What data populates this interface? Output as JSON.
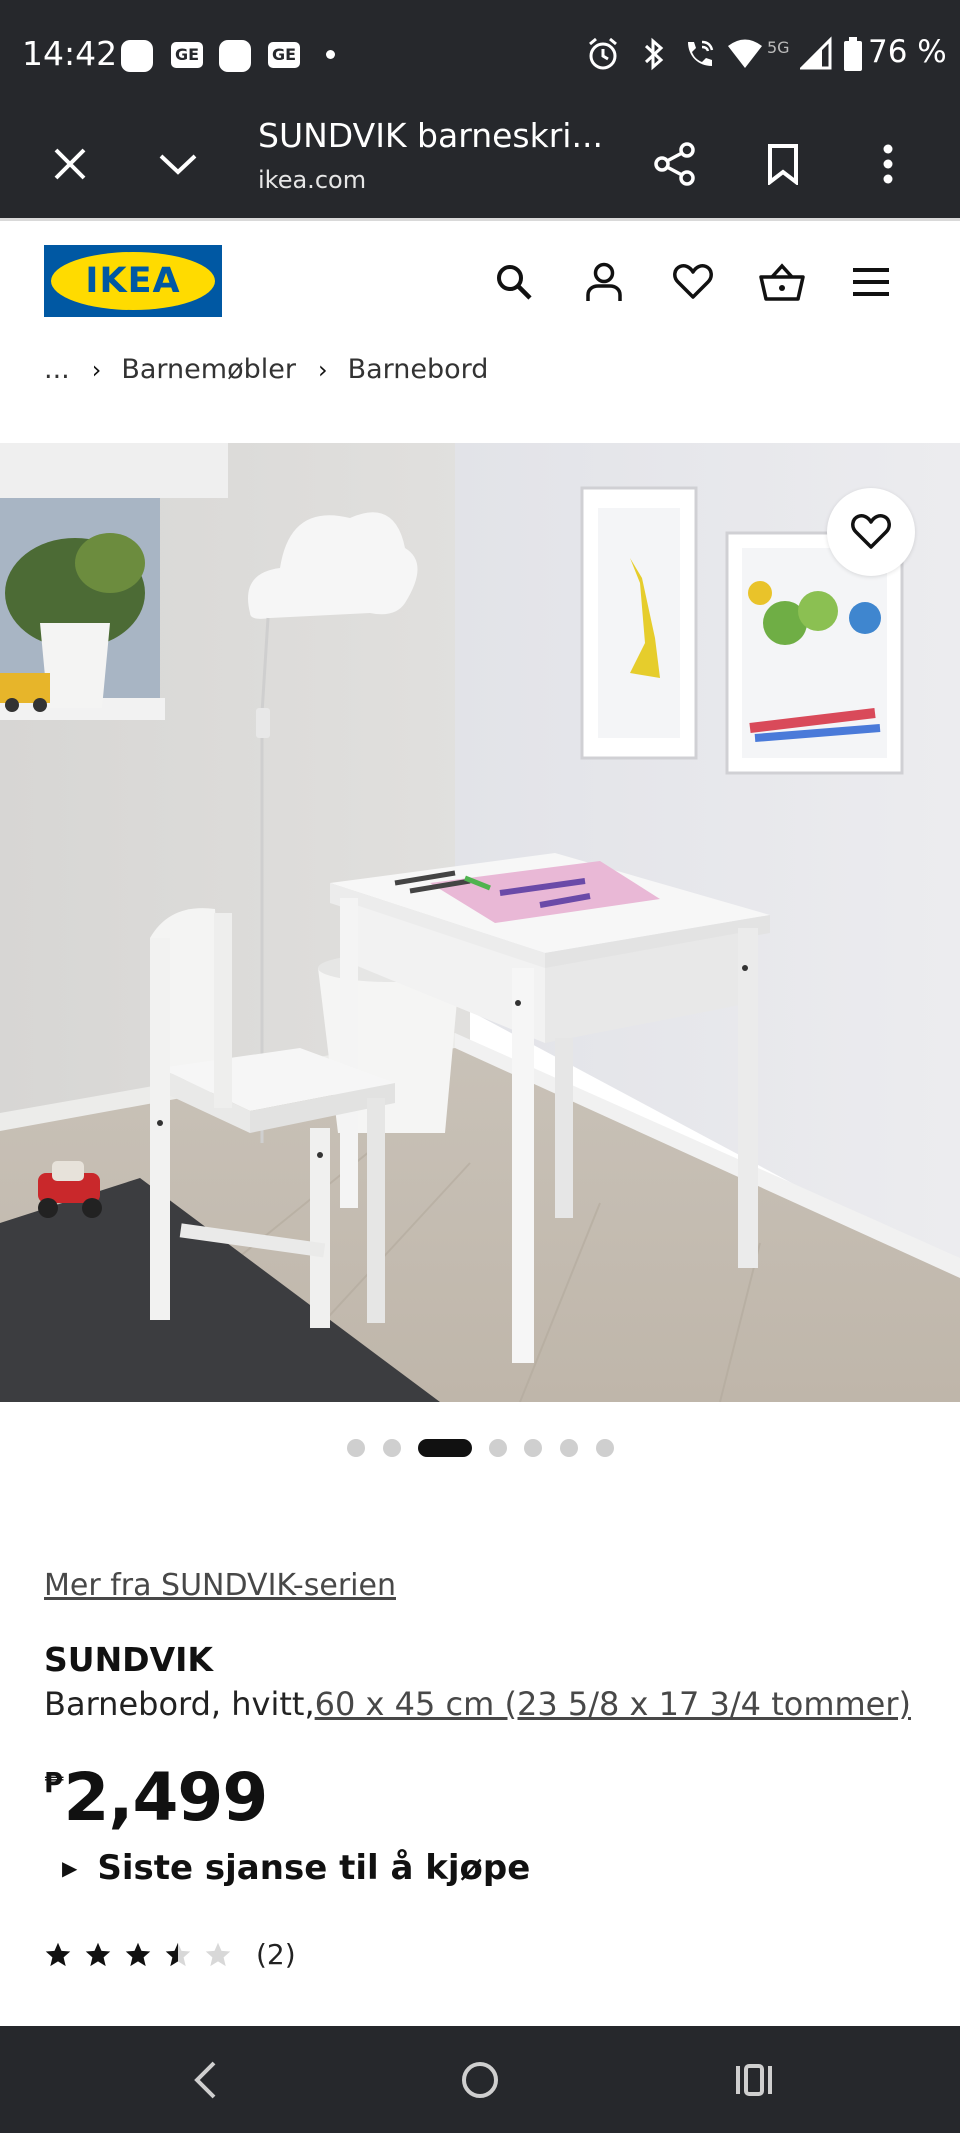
{
  "status_bar": {
    "time": "14:42",
    "notifications": [
      "app-icon",
      "GE",
      "app-icon",
      "GE"
    ],
    "network": "5G",
    "battery": "76 %"
  },
  "browser": {
    "title": "SUNDVIK barneskri...",
    "domain": "ikea.com",
    "icons": [
      "close-icon",
      "chevron-down-icon",
      "share-icon",
      "bookmark-icon",
      "more-vert-icon"
    ]
  },
  "header": {
    "logo_text": "IKEA",
    "icons": [
      "search-icon",
      "account-icon",
      "heart-icon",
      "basket-icon",
      "menu-icon"
    ]
  },
  "breadcrumb": {
    "ellipsis": "...",
    "items": [
      "Barnemøbler",
      "Barnebord"
    ]
  },
  "gallery": {
    "dot_count": 7,
    "active_index": 2,
    "favorite_icon": "heart-icon"
  },
  "product": {
    "series_link": "Mer fra SUNDVIK-serien",
    "name": "SUNDVIK",
    "description": "Barnebord, hvitt,",
    "size": "60 x 45 cm (23 5/8 x 17 3/4 tommer)",
    "currency": "₱",
    "price": "2,499",
    "notice": "Siste sjanse til å kjøpe",
    "rating": 3.5,
    "rating_max": 5,
    "review_count": "(2)"
  },
  "colors": {
    "system_bar": "#26282c",
    "ikea_blue": "#0058a3",
    "ikea_yellow": "#ffdb00",
    "text": "#111111",
    "star_empty": "#d8d8d8"
  },
  "nav_bar": {
    "icons": [
      "back-icon",
      "home-icon",
      "recents-icon"
    ]
  }
}
